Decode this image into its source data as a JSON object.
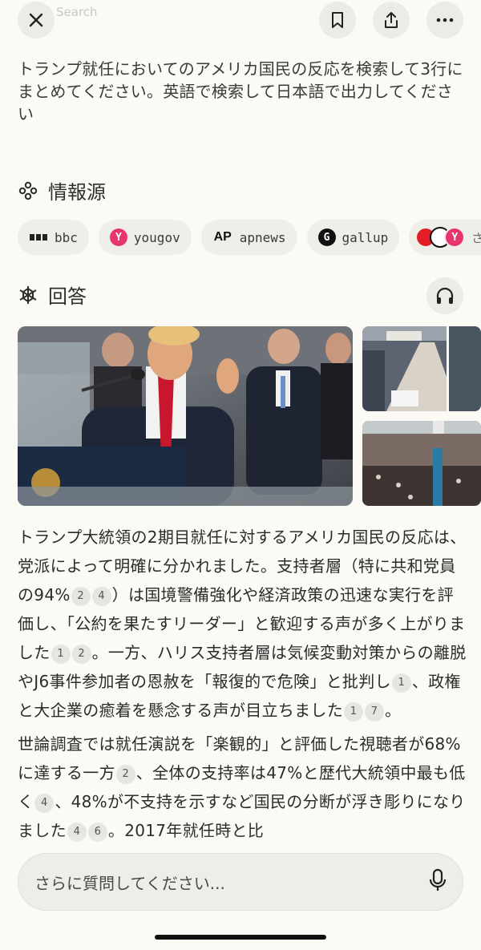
{
  "header": {
    "ghost_title": "o Search",
    "close_icon": "close-icon",
    "bookmark_icon": "bookmark-icon",
    "share_icon": "share-icon",
    "more_icon": "more-icon"
  },
  "query": "トランプ就任においてのアメリカ国民の反応を検索して3行にまとめてください。英語で検索して日本語で出力してください",
  "sources_section": {
    "title": "情報源",
    "icon": "sources-icon",
    "chips": [
      {
        "label": "bbc",
        "icon": "bbc-icon",
        "color": "#222222"
      },
      {
        "label": "yougov",
        "icon": "yougov-icon",
        "color": "#e8356b"
      },
      {
        "label": "apnews",
        "icon": "apnews-icon",
        "color": "#e21d25"
      },
      {
        "label": "gallup",
        "icon": "gallup-icon",
        "color": "#111111"
      }
    ],
    "more_label": "さらに"
  },
  "answer_section": {
    "title": "回答",
    "icon": "answer-icon",
    "listen_icon": "headphones-icon"
  },
  "answer": {
    "p1": [
      "トランプ大統領の2期目就任に対するアメリカ国民の反応は、党派によって明確に分かれました。支持者層（特に共和党員の94%",
      "）は国境警備強化や経済政策の迅速な実行を評価し、「公約を果たすリーダー」と歓迎する声が多く上がりました",
      "。一方、ハリス支持者層は気候変動対策からの離脱やJ6事件参加者の恩赦を「報復的で危険」と批判し",
      "、政権と大企業の癒着を懸念する声が目立ちました",
      "。"
    ],
    "p1_cites": [
      "2",
      "4",
      "1",
      "2",
      "1",
      "1",
      "7"
    ],
    "p2": [
      "世論調査では就任演説を「楽観的」と評価した視聴者が68%に達する一方",
      "、全体の支持率は47%と歴代大統領中最も低く",
      "、48%が不支持を示すなど国民の分断が浮き彫りになりました",
      "。2017年就任時と比"
    ],
    "p2_cites": [
      "2",
      "4",
      "4",
      "6"
    ]
  },
  "composer": {
    "placeholder": "さらに質問してください...",
    "mic_icon": "microphone-icon"
  },
  "colors": {
    "background": "#fbfaf5",
    "chip_bg": "#efeee8",
    "button_bg": "#ecebe5"
  }
}
